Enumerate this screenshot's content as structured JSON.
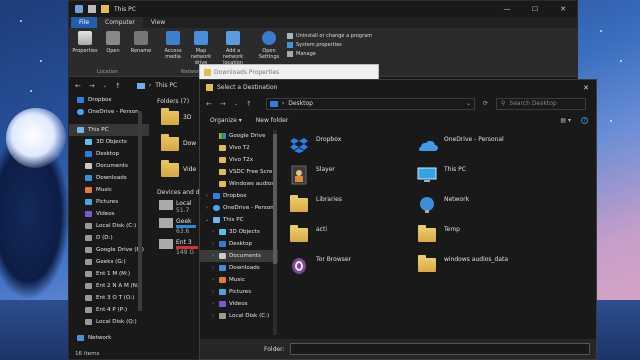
{
  "explorer": {
    "title": "This PC",
    "tabs": [
      "File",
      "Computer",
      "View"
    ],
    "ribbon": {
      "buttons": [
        "Properties",
        "Open",
        "Rename",
        "Access media",
        "Map network drive",
        "Add a network location",
        "Open Settings"
      ],
      "system": [
        "Uninstall or change a program",
        "System properties",
        "Manage"
      ],
      "groups": [
        "Location",
        "Network"
      ]
    },
    "address": "This PC",
    "nav": {
      "items": [
        {
          "label": "Dropbox",
          "type": "dropbox"
        },
        {
          "label": "OneDrive - Person",
          "type": "onedrive"
        },
        {
          "label": "This PC",
          "type": "pc",
          "selected": true
        },
        {
          "label": "3D Objects",
          "type": "folder3d",
          "sub": true
        },
        {
          "label": "Desktop",
          "type": "desktop",
          "sub": true
        },
        {
          "label": "Documents",
          "type": "docs",
          "sub": true
        },
        {
          "label": "Downloads",
          "type": "downloads",
          "sub": true
        },
        {
          "label": "Music",
          "type": "music",
          "sub": true
        },
        {
          "label": "Pictures",
          "type": "pictures",
          "sub": true
        },
        {
          "label": "Videos",
          "type": "videos",
          "sub": true
        },
        {
          "label": "Local Disk (C:)",
          "type": "drive",
          "sub": true
        },
        {
          "label": "D (D:)",
          "type": "drive",
          "sub": true
        },
        {
          "label": "Google Drive (E:)",
          "type": "drive",
          "sub": true
        },
        {
          "label": "Geeks (G:)",
          "type": "drive",
          "sub": true
        },
        {
          "label": "Ent 1 M (M:)",
          "type": "drive",
          "sub": true
        },
        {
          "label": "Ent 2 N A M (N:)",
          "type": "drive",
          "sub": true
        },
        {
          "label": "Ent 3 O T (O:)",
          "type": "drive",
          "sub": true
        },
        {
          "label": "Ent 4 P (P:)",
          "type": "drive",
          "sub": true
        },
        {
          "label": "Local Disk (Q:)",
          "type": "drive",
          "sub": true
        },
        {
          "label": "Network",
          "type": "network"
        }
      ]
    },
    "pane": {
      "folders_header": "Folders (7)",
      "folders": [
        "3D",
        "Dow",
        "Vide"
      ],
      "devices_header": "Devices and d",
      "devices": [
        {
          "name": "Local",
          "size": "51.7"
        },
        {
          "name": "Geek",
          "size": "63.6"
        },
        {
          "name": "Ent 3",
          "size": "149 G"
        }
      ]
    },
    "status": "16 items"
  },
  "properties": {
    "title": "Downloads Properties"
  },
  "dialog": {
    "title": "Select a Destination",
    "path": "Desktop",
    "search_placeholder": "Search Desktop",
    "toolbar": {
      "organize": "Organize",
      "new_folder": "New folder"
    },
    "nav": [
      {
        "label": "Google Drive",
        "type": "gdrive",
        "indent": 1
      },
      {
        "label": "Vivo T2",
        "type": "folder",
        "indent": 1
      },
      {
        "label": "Vivo T2x",
        "type": "folder",
        "indent": 1
      },
      {
        "label": "VSDC Free Scre",
        "type": "folder",
        "indent": 1
      },
      {
        "label": "Windows audios",
        "type": "folder",
        "indent": 1
      },
      {
        "label": "Dropbox",
        "type": "dropbox",
        "indent": 0,
        "chev": true
      },
      {
        "label": "OneDrive - Person",
        "type": "onedrive",
        "indent": 0,
        "chev": true
      },
      {
        "label": "This PC",
        "type": "pc",
        "indent": 0,
        "chev": true,
        "open": true
      },
      {
        "label": "3D Objects",
        "type": "folder3d",
        "indent": 1,
        "chev": true
      },
      {
        "label": "Desktop",
        "type": "desktop",
        "indent": 1,
        "chev": true
      },
      {
        "label": "Documents",
        "type": "docs",
        "indent": 1,
        "chev": true,
        "selected": true
      },
      {
        "label": "Downloads",
        "type": "downloads",
        "indent": 1,
        "chev": true
      },
      {
        "label": "Music",
        "type": "music",
        "indent": 1,
        "chev": true
      },
      {
        "label": "Pictures",
        "type": "pictures",
        "indent": 1,
        "chev": true
      },
      {
        "label": "Videos",
        "type": "videos",
        "indent": 1,
        "chev": true
      },
      {
        "label": "Local Disk (C:)",
        "type": "drive",
        "indent": 1,
        "chev": true
      }
    ],
    "items": [
      {
        "label": "Dropbox",
        "type": "dropbox"
      },
      {
        "label": "OneDrive - Personal",
        "type": "onedrive"
      },
      {
        "label": "Slayer",
        "type": "user"
      },
      {
        "label": "This PC",
        "type": "pc"
      },
      {
        "label": "Libraries",
        "type": "libraries"
      },
      {
        "label": "Network",
        "type": "network"
      },
      {
        "label": "acti",
        "type": "folder"
      },
      {
        "label": "Temp",
        "type": "folder"
      },
      {
        "label": "Tor Browser",
        "type": "tor"
      },
      {
        "label": "windows audios_data",
        "type": "folder"
      }
    ],
    "folder_label": "Folder:"
  }
}
